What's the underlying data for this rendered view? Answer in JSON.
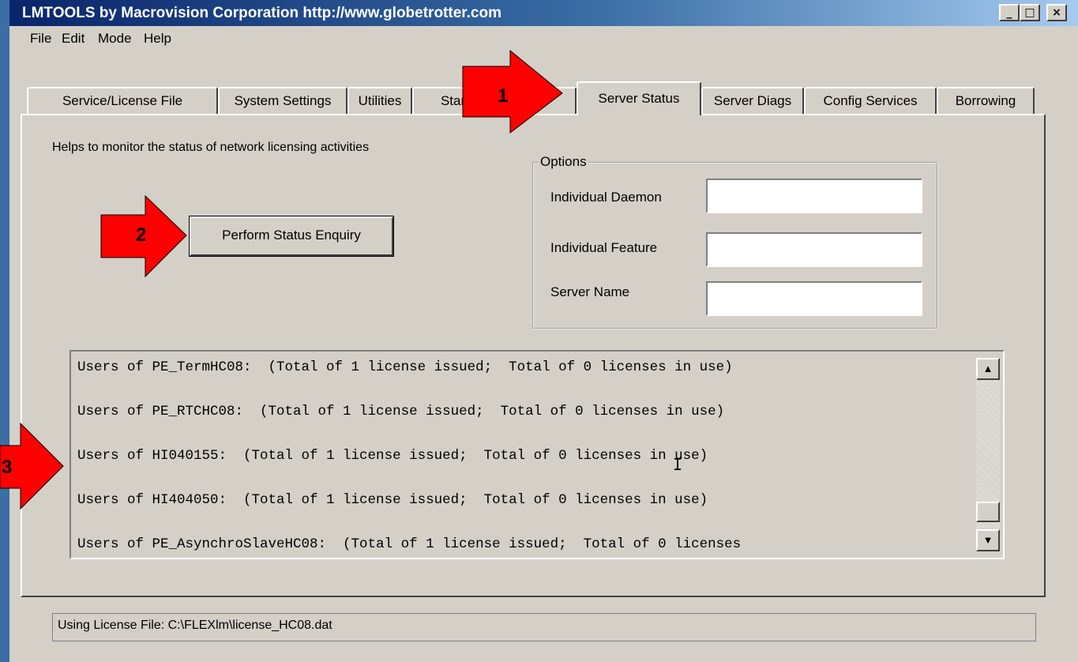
{
  "window": {
    "title": "LMTOOLS by Macrovision Corporation http://www.globetrotter.com",
    "controls": {
      "minimize": "_",
      "maximize": "□",
      "close": "×"
    }
  },
  "menu": [
    "File",
    "Edit",
    "Mode",
    "Help"
  ],
  "tabs": [
    {
      "label": "Service/License File"
    },
    {
      "label": "System Settings"
    },
    {
      "label": "Utilities"
    },
    {
      "label": "Start/Stop/Reread"
    },
    {
      "label": "Server Status",
      "active": true
    },
    {
      "label": "Server Diags"
    },
    {
      "label": "Config Services"
    },
    {
      "label": "Borrowing"
    }
  ],
  "panel": {
    "description": "Helps to monitor the status of network licensing activities",
    "perform_button": "Perform Status Enquiry",
    "options": {
      "title": "Options",
      "individual_daemon_label": "Individual Daemon",
      "individual_feature_label": "Individual Feature",
      "server_name_label": "Server Name",
      "individual_daemon_value": "",
      "individual_feature_value": "",
      "server_name_value": ""
    },
    "output_lines": [
      "Users of PE_TermHC08:  (Total of 1 license issued;  Total of 0 licenses in use)",
      "Users of PE_RTCHC08:  (Total of 1 license issued;  Total of 0 licenses in use)",
      "Users of HI040155:  (Total of 1 license issued;  Total of 0 licenses in use)",
      "Users of HI404050:  (Total of 1 license issued;  Total of 0 licenses in use)",
      "Users of PE_AsynchroSlaveHC08:  (Total of 1 license issued;  Total of 0 licenses"
    ]
  },
  "status_bar": "Using License File:  C:\\FLEXlm\\license_HC08.dat",
  "annotations": [
    "1",
    "2",
    "3"
  ],
  "colors": {
    "arrow_fill": "#ff0000",
    "title_bar": "#0a246a",
    "face": "#d4d0c8"
  }
}
